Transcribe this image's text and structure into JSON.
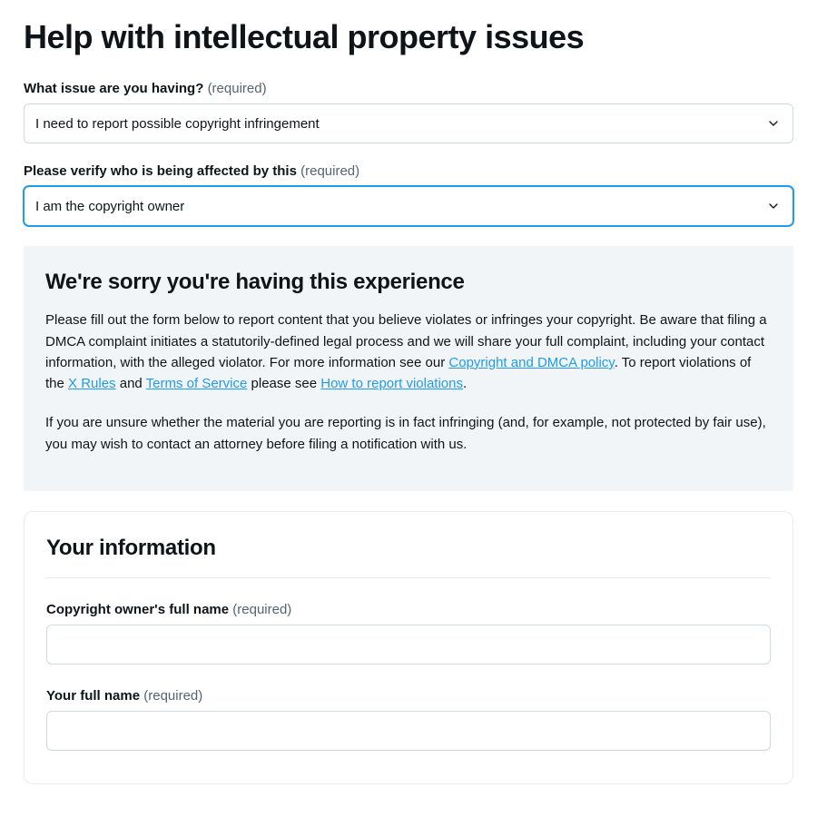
{
  "page": {
    "title": "Help with intellectual property issues"
  },
  "labels": {
    "required": "(required)"
  },
  "q_issue": {
    "label": "What issue are you having?",
    "selected": "I need to report possible copyright infringement"
  },
  "q_affected": {
    "label": "Please verify who is being affected by this",
    "selected": "I am the copyright owner"
  },
  "info": {
    "heading": "We're sorry you're having this experience",
    "p1_a": "Please fill out the form below to report content that you believe violates or infringes your copyright. Be aware that filing a DMCA complaint initiates a statutorily-defined legal process and we will share your full complaint, including your contact information, with the alleged violator. For more information see our ",
    "link_dmca": "Copyright and DMCA policy",
    "p1_b": ". To report violations of the ",
    "link_xrules": "X Rules",
    "p1_c": " and ",
    "link_tos": "Terms of Service",
    "p1_d": " please see ",
    "link_howto": "How to report violations",
    "p1_e": ".",
    "p2": "If you are unsure whether the material you are reporting is in fact infringing (and, for example, not protected by fair use), you may wish to contact an attorney before filing a notification with us."
  },
  "your_info": {
    "heading": "Your information",
    "owner_name_label": "Copyright owner's full name",
    "your_name_label": "Your full name"
  }
}
